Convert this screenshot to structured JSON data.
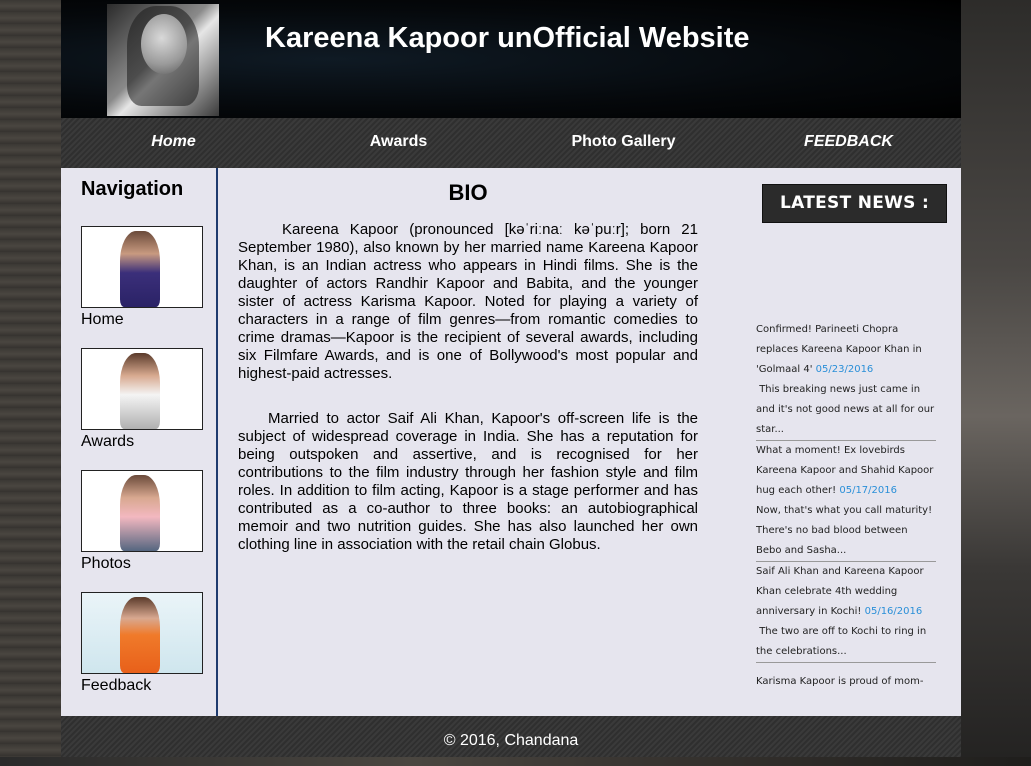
{
  "header": {
    "title": "Kareena Kapoor unOfficial Website"
  },
  "nav": {
    "items": [
      {
        "label": "Home"
      },
      {
        "label": "Awards"
      },
      {
        "label": "Photo Gallery"
      },
      {
        "label": "FEEDBACK"
      }
    ]
  },
  "sidebar": {
    "heading": "Navigation",
    "links": [
      {
        "label": "Home"
      },
      {
        "label": "Awards"
      },
      {
        "label": "Photos"
      },
      {
        "label": "Feedback"
      }
    ]
  },
  "bio": {
    "title": "BIO",
    "paragraphs": [
      "Kareena Kapoor (pronounced [kəˈriːnaː kəˈpuːr]; born 21 September 1980), also known by her married name Kareena Kapoor Khan, is an Indian actress who appears in Hindi films. She is the daughter of actors Randhir Kapoor and Babita, and the younger sister of actress Karisma Kapoor. Noted for playing a variety of characters in a range of film genres—from romantic comedies to crime dramas—Kapoor is the recipient of several awards, including six Filmfare Awards, and is one of Bollywood's most popular and highest-paid actresses.",
      "Married to actor Saif Ali Khan, Kapoor's off-screen life is the subject of widespread coverage in India. She has a reputation for being outspoken and assertive, and is recognised for her contributions to the film industry through her fashion style and film roles. In addition to film acting, Kapoor is a stage performer and has contributed as a co-author to three books: an autobiographical memoir and two nutrition guides. She has also launched her own clothing line in association with the retail chain Globus."
    ]
  },
  "news": {
    "heading": "LATEST NEWS :",
    "items": [
      {
        "headline": "Confirmed! Parineeti Chopra replaces Kareena Kapoor Khan in 'Golmaal 4'",
        "date": "05/23/2016",
        "summary": "This breaking news just came in and it's not good news at all for our star..."
      },
      {
        "headline": "What a moment! Ex lovebirds Kareena Kapoor and Shahid Kapoor hug each other!",
        "date": "05/17/2016",
        "summary": "Now, that's what you call maturity! There's no bad blood between Bebo and Sasha..."
      },
      {
        "headline": "Saif Ali Khan and Kareena Kapoor Khan celebrate 4th wedding anniversary in Kochi!",
        "date": "05/16/2016",
        "summary": "The two are off to Kochi to ring in the celebrations..."
      },
      {
        "headline": "Karisma Kapoor is proud of mom-",
        "date": "",
        "summary": ""
      }
    ]
  },
  "footer": {
    "text": "© 2016, Chandana"
  },
  "colors": {
    "nav_border": "#1f3b6e",
    "news_date": "#2a8fd8"
  }
}
